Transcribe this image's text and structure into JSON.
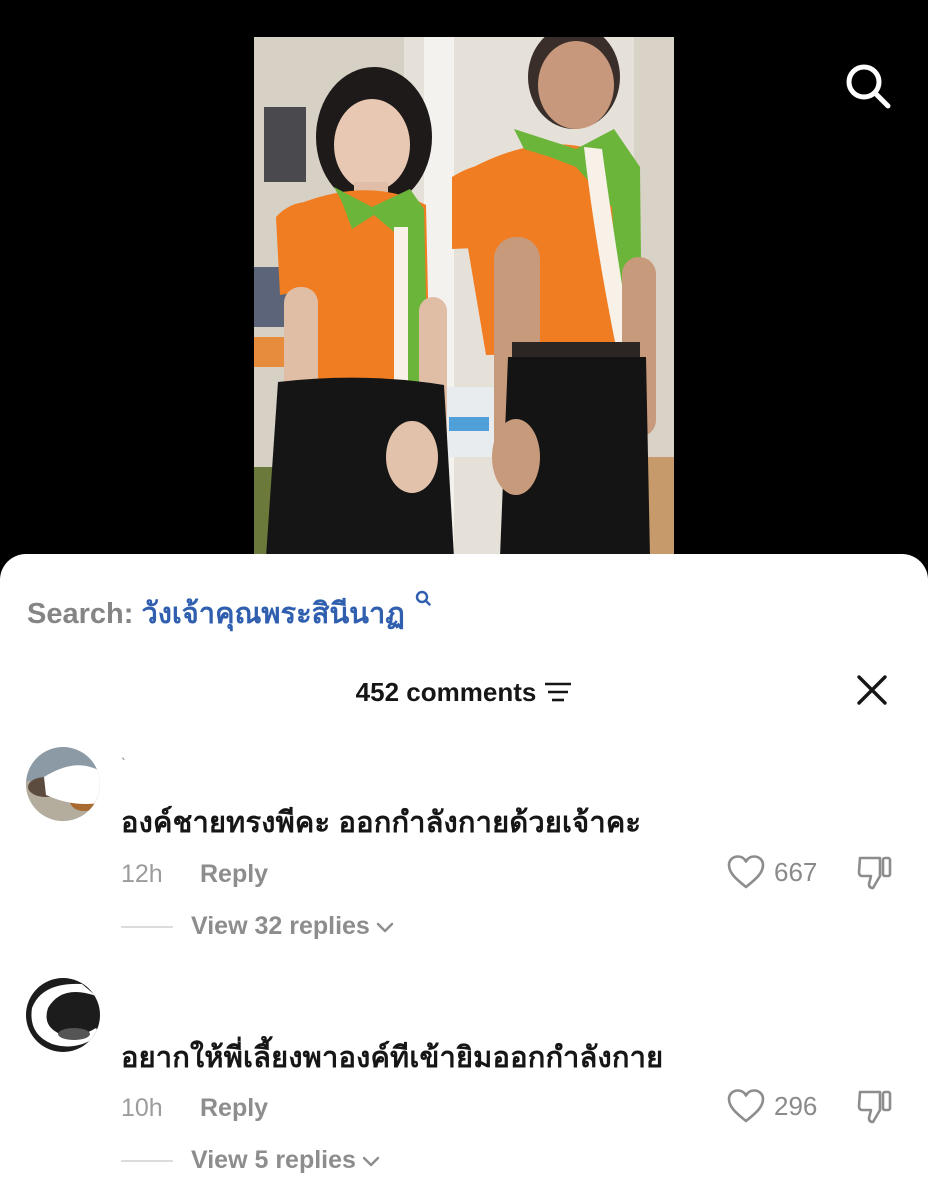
{
  "search_bar": {
    "label": "Search:",
    "query": "วังเจ้าคุณพระสินีนาฏ"
  },
  "header": {
    "comment_count": "452 comments"
  },
  "comments": [
    {
      "username": "ˎ",
      "text": "องค์ชายทรงพีคะ ออกกำลังกายด้วยเจ้าคะ",
      "time": "12h",
      "reply_label": "Reply",
      "likes": "667",
      "view_replies": "View 32 replies"
    },
    {
      "text": "อยากให้พี่เลี้ยงพาองค์ทีเข้ายิมออกกำลังกาย",
      "time": "10h",
      "reply_label": "Reply",
      "likes": "296",
      "view_replies": "View 5 replies"
    }
  ],
  "icons": {
    "top_search": "search-icon",
    "sort": "sort-icon",
    "close": "close-icon",
    "like": "heart-icon",
    "dislike": "thumbs-down-icon",
    "expand": "chevron-down-icon"
  },
  "colors": {
    "search_query": "#2f5fae",
    "background_video": "#000000",
    "sheet": "#ffffff"
  }
}
